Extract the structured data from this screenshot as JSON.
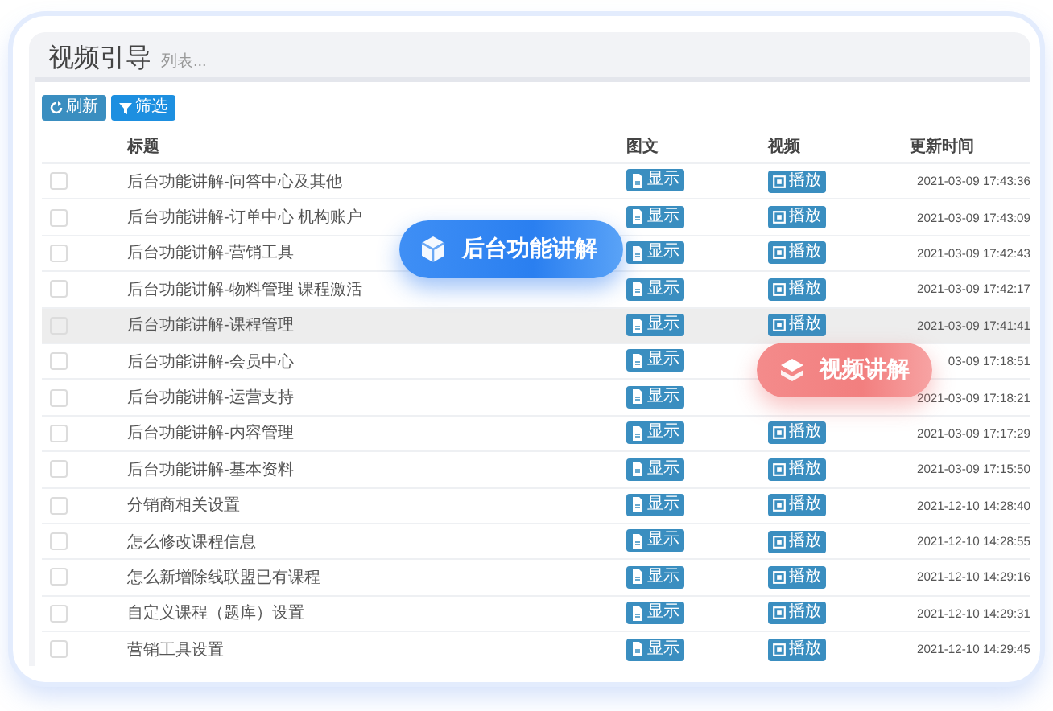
{
  "panel": {
    "title": "视频引导",
    "subtitle": "列表..."
  },
  "toolbar": [
    {
      "kind": "refresh",
      "label": "刷新"
    },
    {
      "kind": "filter",
      "label": "筛选"
    }
  ],
  "table": {
    "columns": [
      "标题",
      "图文",
      "视频",
      "更新时间"
    ],
    "rows": [
      {
        "checked": false,
        "hovered": false,
        "title": "后台功能讲解-问答中心及其他",
        "doc": "显示",
        "play": "播放",
        "time": "2021-03-09 17:43:36"
      },
      {
        "checked": false,
        "hovered": false,
        "title": "后台功能讲解-订单中心 机构账户",
        "doc": "显示",
        "play": "播放",
        "time": "2021-03-09 17:43:09"
      },
      {
        "checked": false,
        "hovered": false,
        "title": "后台功能讲解-营销工具",
        "doc": "显示",
        "play": "播放",
        "time": "2021-03-09 17:42:43"
      },
      {
        "checked": false,
        "hovered": false,
        "title": "后台功能讲解-物料管理 课程激活",
        "doc": "显示",
        "play": "播放",
        "time": "2021-03-09 17:42:17"
      },
      {
        "checked": false,
        "hovered": true,
        "title": "后台功能讲解-课程管理",
        "doc": "显示",
        "play": "播放",
        "time": "2021-03-09 17:41:41"
      },
      {
        "checked": false,
        "hovered": false,
        "title": "后台功能讲解-会员中心",
        "doc": "显示",
        "time": "03-09 17:18:51"
      },
      {
        "checked": false,
        "hovered": false,
        "title": "后台功能讲解-运营支持",
        "doc": "显示",
        "time": "2021-03-09 17:18:21"
      },
      {
        "checked": false,
        "hovered": false,
        "title": "后台功能讲解-内容管理",
        "doc": "显示",
        "play": "播放",
        "time": "2021-03-09 17:17:29"
      },
      {
        "checked": false,
        "hovered": false,
        "title": "后台功能讲解-基本资料",
        "doc": "显示",
        "play": "播放",
        "time": "2021-03-09 17:15:50"
      },
      {
        "checked": false,
        "hovered": false,
        "title": "分销商相关设置",
        "doc": "显示",
        "play": "播放",
        "time": "2021-12-10 14:28:40"
      },
      {
        "checked": false,
        "hovered": false,
        "title": "怎么修改课程信息",
        "doc": "显示",
        "play": "播放",
        "time": "2021-12-10 14:28:55"
      },
      {
        "checked": false,
        "hovered": false,
        "title": "怎么新增除线联盟已有课程",
        "doc": "显示",
        "play": "播放",
        "time": "2021-12-10 14:29:16"
      },
      {
        "checked": false,
        "hovered": false,
        "title": "自定义课程（题库）设置",
        "doc": "显示",
        "play": "播放",
        "time": "2021-12-10 14:29:31"
      },
      {
        "checked": false,
        "hovered": false,
        "title": "营销工具设置",
        "doc": "显示",
        "play": "播放",
        "time": "2021-12-10 14:29:45"
      }
    ]
  },
  "callouts": [
    {
      "kind": "backend",
      "label": "后台功能讲解"
    },
    {
      "kind": "video",
      "label": "视频讲解"
    }
  ]
}
